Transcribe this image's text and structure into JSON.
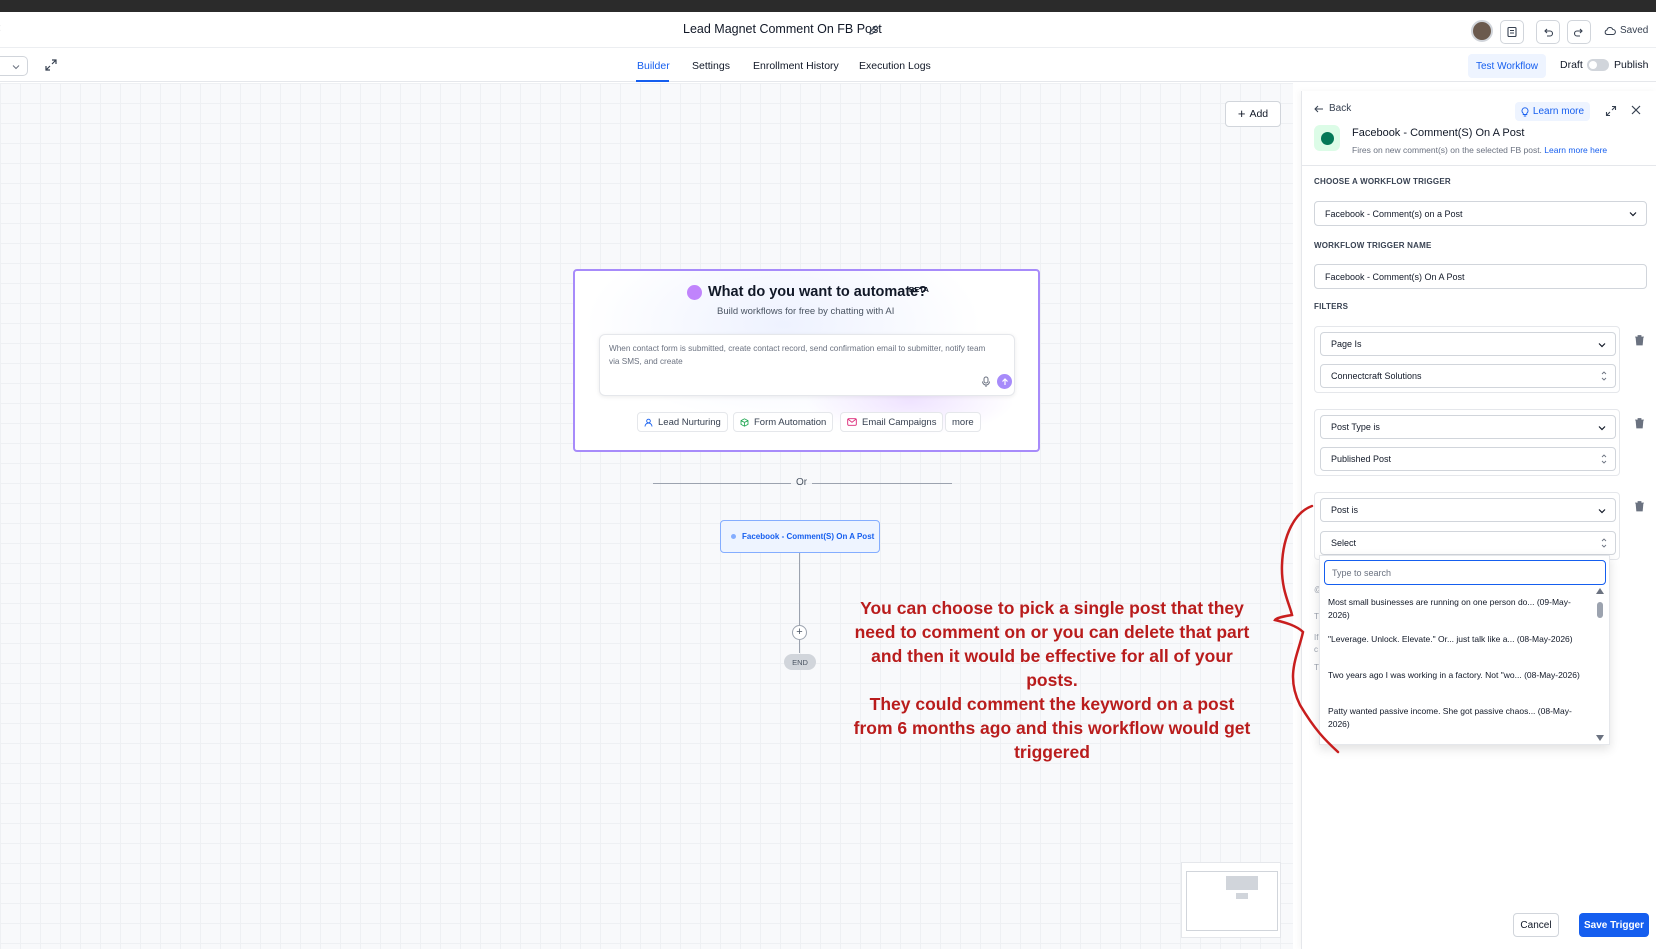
{
  "header": {
    "workflow_title": "Lead Magnet Comment On FB Post",
    "saved_label": "Saved"
  },
  "tabs": [
    {
      "label": "Builder",
      "active": true
    },
    {
      "label": "Settings",
      "active": false
    },
    {
      "label": "Enrollment History",
      "active": false
    },
    {
      "label": "Execution Logs",
      "active": false
    }
  ],
  "toolbar": {
    "test_workflow_label": "Test Workflow",
    "draft_label": "Draft",
    "publish_label": "Publish"
  },
  "canvas": {
    "add_label": "Add",
    "ai_card": {
      "title": "What do you want to automate?",
      "badge": "BETA",
      "subtitle": "Build workflows for free by chatting with AI",
      "input_placeholder": "When contact form is submitted, create contact record, send confirmation email to submitter, notify team via SMS, and create",
      "chips": [
        {
          "label": "Lead Nurturing",
          "icon": "user-icon"
        },
        {
          "label": "Form Automation",
          "icon": "cube-icon"
        },
        {
          "label": "Email Campaigns",
          "icon": "mail-icon"
        },
        {
          "label": "more",
          "icon": ""
        }
      ]
    },
    "or_label": "Or",
    "trigger_node_label": "Facebook - Comment(S) On A Post",
    "end_label": "END",
    "annotation": "You can choose to pick a single post that they need to comment on or you can delete that part and then it would be effective for all of your posts.\nThey could comment the keyword on a post from 6 months ago and this workflow would get triggered"
  },
  "panel": {
    "back_label": "Back",
    "learn_more_label": "Learn more",
    "trigger_title": "Facebook - Comment(S) On A Post",
    "trigger_desc": "Fires on new comment(s) on the selected FB post.",
    "trigger_desc_link": "Learn more here",
    "choose_trigger_label": "CHOOSE A WORKFLOW TRIGGER",
    "choose_trigger_value": "Facebook - Comment(s) on a Post",
    "trigger_name_label": "WORKFLOW TRIGGER NAME",
    "trigger_name_value": "Facebook - Comment(s) On A Post",
    "filters_label": "FILTERS",
    "filters": [
      {
        "field": "Page Is",
        "value": "Connectcraft Solutions"
      },
      {
        "field": "Post Type is",
        "value": "Published Post"
      },
      {
        "field": "Post is",
        "value": "Select"
      }
    ],
    "dropdown": {
      "search_placeholder": "Type to search",
      "options": [
        "Most small businesses are running on one person do... (09-May-2026)",
        "\"Leverage. Unlock. Elevate.\" Or... just talk like a... (08-May-2026)",
        "Two years ago I was working in a factory. Not \"wo... (08-May-2026)",
        "Patty wanted passive income. She got passive chaos... (08-May-2026)"
      ]
    },
    "cancel_label": "Cancel",
    "save_label": "Save Trigger"
  },
  "colors": {
    "primary": "#155eef",
    "ai_border": "#a78bfa",
    "annotation": "#b91c1c"
  }
}
